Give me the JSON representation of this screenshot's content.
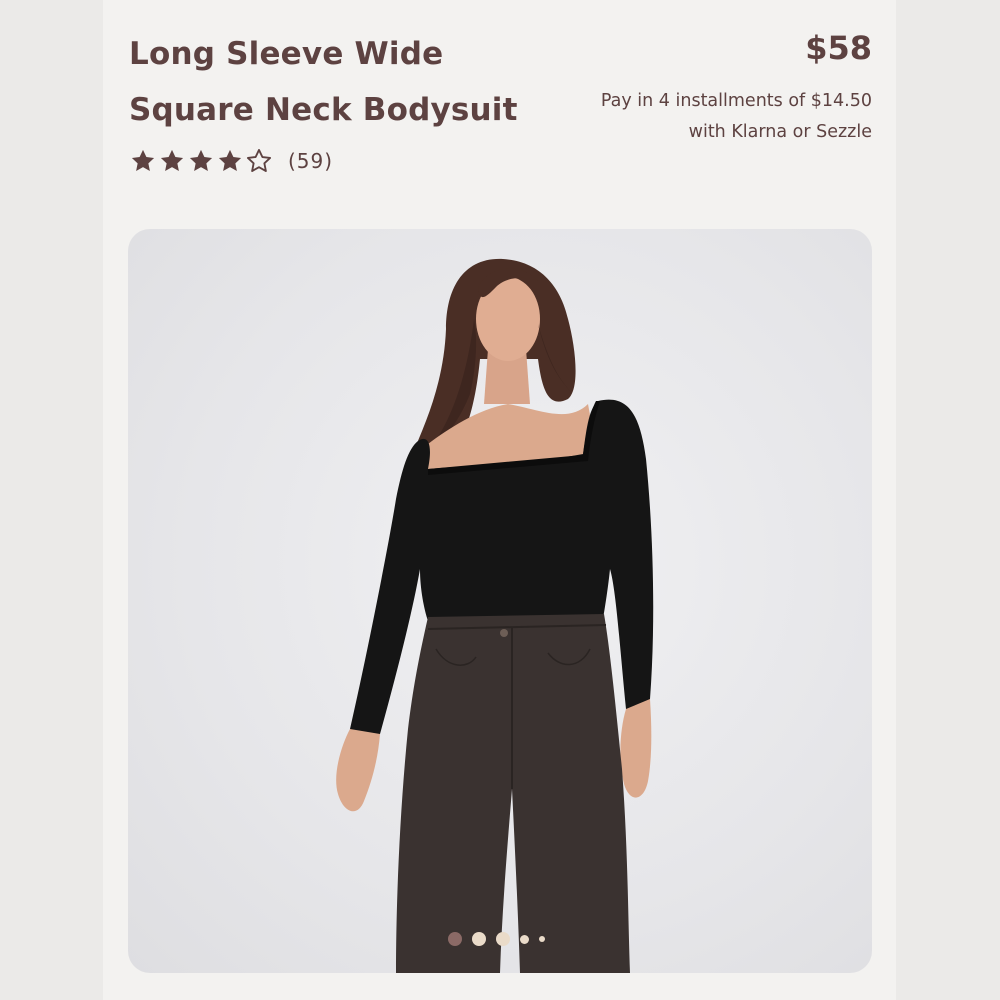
{
  "product": {
    "title_line1": "Long Sleeve Wide",
    "title_line2": "Square Neck Bodysuit",
    "price": "$58",
    "installments_line1": "Pay in 4 installments of $14.50",
    "installments_line2": "with Klarna or Sezzle",
    "rating": {
      "stars": 4,
      "max": 5,
      "count": "(59)"
    }
  },
  "gallery": {
    "image_alt": "Model wearing black long sleeve square neck bodysuit with dark wash wide leg jeans",
    "dot_count": 5,
    "active_dot": 0
  },
  "colors": {
    "text": "#5d4241",
    "card_bg": "#f3f2f0",
    "dot_active": "#8b6a66",
    "dot_inactive": "#eadbc9"
  }
}
